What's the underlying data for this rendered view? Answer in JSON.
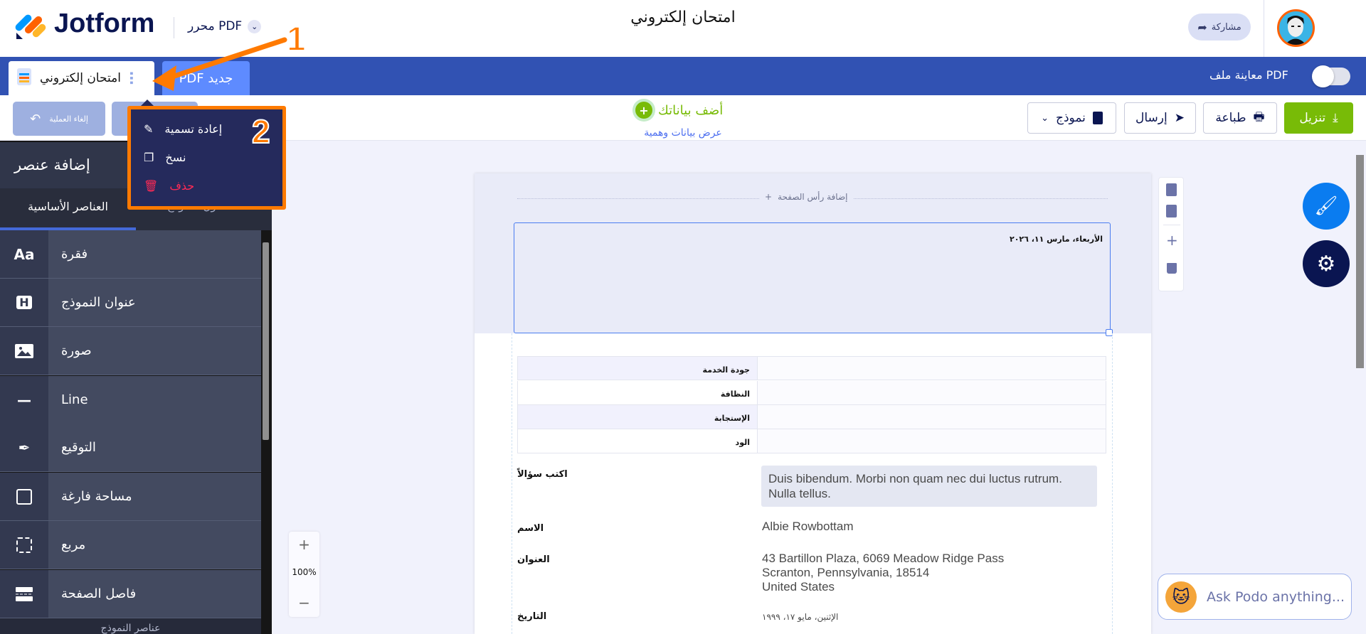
{
  "header": {
    "brand": "Jotform",
    "product": "PDF محرر",
    "title": "امتحان إلكتروني",
    "share": "مشاركة"
  },
  "tabs": [
    {
      "label": "امتحان إلكتروني"
    },
    {
      "label": "جديد PDF"
    }
  ],
  "preview_toggle": {
    "label": "PDF معاينة ملف",
    "on": false
  },
  "toolbar": {
    "undo": "إلغاء العملية",
    "add_data": "أضف بياناتك",
    "dummy_data": "عرض بيانات وهمية",
    "download": "تنزيل",
    "print": "طباعة",
    "send": "إرسال",
    "form": "نموذج"
  },
  "context_menu": {
    "items": [
      "إعادة تسمية",
      "نسخ",
      "حذف"
    ]
  },
  "annotations": {
    "step1": "1",
    "step2": "2"
  },
  "sidebar": {
    "title": "إضافة عنصر",
    "tabs": [
      "العناصر الأساسية",
      "حقول النموذج"
    ],
    "items": [
      {
        "icon": "Aa",
        "label": "فقرة"
      },
      {
        "icon": "H",
        "label": "عنوان النموذج"
      },
      {
        "icon": "image",
        "label": "صورة"
      },
      {
        "icon": "—",
        "label": "Line"
      },
      {
        "icon": "pen",
        "label": "التوقيع"
      },
      {
        "icon": "square",
        "label": "مساحة فارغة"
      },
      {
        "icon": "box",
        "label": "مربع"
      },
      {
        "icon": "page-break",
        "label": "فاصل الصفحة"
      }
    ],
    "footer": "عناصر النموذج"
  },
  "page": {
    "add_header": "إضافة رأس الصفحة",
    "date_text": "الأربعاء، مارس ١١، ٢٠٢٦",
    "table_rows": [
      "جودة الخدمة",
      "النظافة",
      "الإستجابة",
      "الود"
    ],
    "fields": [
      {
        "label": "اكتب سؤالاً",
        "value": "Duis bibendum. Morbi non quam nec dui luctus rutrum. Nulla tellus."
      },
      {
        "label": "الاسم",
        "value": "Albie Rowbottam"
      },
      {
        "label": "العنوان",
        "lines": [
          "43 Bartillon Plaza, 6069 Meadow Ridge Pass",
          "Scranton, Pennsylvania, 18514",
          "United States"
        ]
      },
      {
        "label": "التاريخ",
        "value": "الإثنين، مايو ١٧، ١٩٩٩"
      }
    ]
  },
  "zoom": {
    "level": "100%"
  },
  "podo": {
    "placeholder": "Ask Podo anything..."
  },
  "colors": {
    "blue": "#3152b3",
    "green": "#78bb07",
    "orange": "#ff7a00",
    "dark": "#0a1551"
  }
}
